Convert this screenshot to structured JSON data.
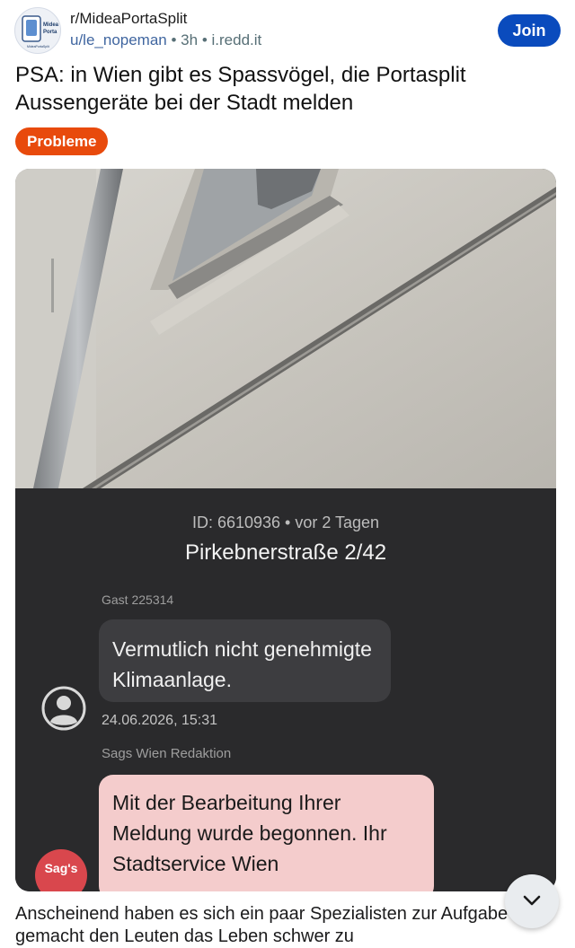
{
  "post": {
    "subreddit": "r/MideaPortaSplit",
    "author": "u/le_nopeman",
    "sep1": " • ",
    "age": "3h",
    "sep2": " • ",
    "domain": "i.redd.it",
    "join_label": "Join",
    "title": "PSA: in Wien gibt es Spassvögel, die Portasplit Aussengeräte bei der Stadt melden",
    "flair": "Probleme",
    "body_preview": "Anscheinend haben es sich ein paar Spezialisten zur Aufgabe gemacht den Leuten das Leben schwer zu"
  },
  "avatar": {
    "line1": "Midea",
    "line2": "Porta",
    "line3": "MideaPortaSplit"
  },
  "screenshot": {
    "report_meta": "ID: 6610936 • vor 2 Tagen",
    "address": "Pirkebnerstraße 2/42",
    "sender1": "Gast 225314",
    "message1": "Vermutlich nicht genehmigte Klimaanlage.",
    "time1": "24.06.2026, 15:31",
    "sender2": "Sags Wien Redaktion",
    "message2": "Mit der Bearbeitung Ihrer Meldung wurde begonnen. Ihr Stadtservice Wien",
    "badge": "Sag's"
  },
  "colors": {
    "join": "#0a4bbd",
    "flair": "#e84a0c",
    "app_bg": "#2a2a2c",
    "bubble_user": "#3d3d40",
    "bubble_city": "#f4cccc"
  },
  "icons": {
    "expand": "chevron-down-icon",
    "user": "user-circle-icon"
  }
}
